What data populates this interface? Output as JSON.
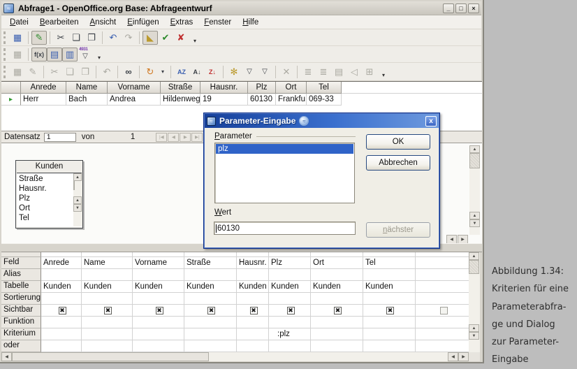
{
  "window": {
    "title": "Abfrage1 - OpenOffice.org Base: Abfrageentwurf",
    "minimize": "_",
    "maximize": "□",
    "close": "×"
  },
  "menu": {
    "items": [
      "Datei",
      "Bearbeiten",
      "Ansicht",
      "Einfügen",
      "Extras",
      "Fenster",
      "Hilfe"
    ]
  },
  "icons": {
    "app": "≈",
    "save": "▦",
    "edit": "✎",
    "cut": "✂",
    "copy": "❏",
    "paste": "❐",
    "undo": "↶",
    "redo": "↷",
    "design_mode": "◣",
    "run_query": "✔",
    "clear_query": "✘",
    "form": "▦",
    "functions": "f(x)",
    "table_name": "▤",
    "alias": "▥",
    "distinct_badge": "4931",
    "funnel": "▽",
    "find": "∞",
    "refresh": "↻",
    "dropdown": "▾",
    "sort_az": "AZ",
    "sort_asc": "A↓",
    "sort_desc": "Z↓",
    "autofilter": "✻",
    "remove_filter": "✕",
    "data_to_text": "≣",
    "data_to_fields": "≣",
    "mail_merge": "▤",
    "data_source": "◁",
    "explorer": "⊞",
    "up": "▲",
    "down": "▼",
    "left": "◀",
    "right": "▶",
    "pointer": "▸"
  },
  "datasheet": {
    "columns": [
      "Anrede",
      "Name",
      "Vorname",
      "Straße",
      "Hausnr.",
      "Plz",
      "Ort",
      "Tel"
    ],
    "row": [
      "Herr",
      "Bach",
      "Andrea",
      "Hildenweg",
      "19",
      "60130",
      "Frankfu",
      "069-33"
    ]
  },
  "recordbar": {
    "label": "Datensatz",
    "value": "1",
    "von": "von",
    "total": "1",
    "nav": [
      "|◀",
      "◀",
      "▶",
      "▶|"
    ]
  },
  "tablebox": {
    "title": "Kunden",
    "fields": [
      "Straße",
      "Hausnr.",
      "Plz",
      "Ort",
      "Tel"
    ]
  },
  "design": {
    "rows": [
      "Feld",
      "Alias",
      "Tabelle",
      "Sortierung",
      "Sichtbar",
      "Funktion",
      "Kriterium",
      "oder"
    ],
    "feld": [
      "Anrede",
      "Name",
      "Vorname",
      "Straße",
      "Hausnr.",
      "Plz",
      "Ort",
      "Tel"
    ],
    "tabelle": [
      "Kunden",
      "Kunden",
      "Kunden",
      "Kunden",
      "Kunden",
      "Kunden",
      "Kunden",
      "Kunden"
    ],
    "kriterium": ":plz",
    "check": "✖"
  },
  "dialog": {
    "title": "Parameter-Eingabe",
    "group": "Parameter",
    "param": "plz",
    "wert_label": "Wert",
    "wert_value": "60130",
    "ok": "OK",
    "cancel": "Abbrechen",
    "next": "nächster",
    "close": "x"
  },
  "caption": {
    "lines": [
      "Abbildung 1.34:",
      "Kriterien für eine",
      "Parameterabfra-",
      "ge und Dialog",
      "zur Parameter-",
      "Eingabe"
    ]
  }
}
